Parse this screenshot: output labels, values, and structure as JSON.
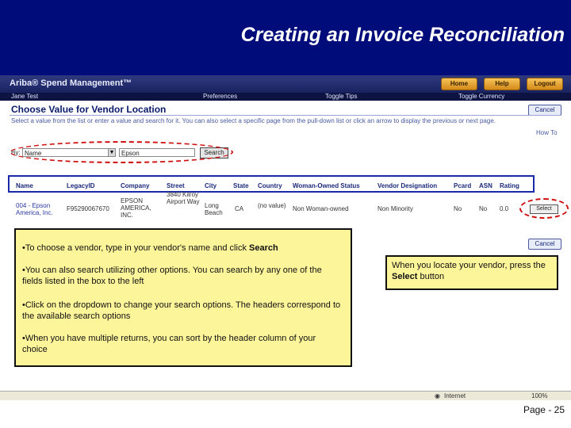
{
  "slide": {
    "title": "Creating an Invoice Reconciliation",
    "page_number": "Page - 25"
  },
  "app": {
    "logo": "Ariba® Spend Management™",
    "nav_buttons": [
      "Home",
      "Help",
      "Logout"
    ],
    "user": "Jane Test",
    "menu": [
      "Preferences",
      "Toggle Tips",
      "Toggle Currency"
    ],
    "panel_title": "Choose Value for Vendor Location",
    "cancel_label": "Cancel",
    "instructions": "Select a value from the list or enter a value and search for it. You can also select a specific page from the pull-down list or click an arrow to display the previous or next page.",
    "how_to": "How To",
    "search": {
      "label": "By:",
      "filter_value": "Name",
      "query_value": "Epson",
      "button": "Search"
    },
    "columns": [
      "Name",
      "LegacyID",
      "Company",
      "Street",
      "City",
      "State",
      "Country",
      "Woman-Owned Status",
      "Vendor Designation",
      "Pcard",
      "ASN",
      "Rating"
    ],
    "rows": [
      {
        "name": "004 - Epson America, Inc.",
        "legacy_id": "F95290067670",
        "company": "EPSON AMERICA, INC.",
        "street": "3840 Kilroy Airport Way",
        "city": "Long Beach",
        "state": "CA",
        "country": "(no value)",
        "woman_owned": "Non Woman-owned",
        "designation": "Non Minority",
        "pcard": "No",
        "asn": "No",
        "rating": "0.0",
        "select_label": "Select"
      }
    ],
    "status_zone": "Internet",
    "zoom": "100%"
  },
  "callouts": {
    "main": [
      "•To choose a vendor, type in your vendor's name and click ",
      "Search",
      "•You can also search utilizing other options.  You can search by any one of the fields listed in the box to the left",
      "•Click on the dropdown to change your search options. The headers correspond to the available search options",
      "•When you have multiple returns, you can sort by the header column of your choice"
    ],
    "right_prefix": "When you locate your vendor, press the ",
    "right_bold": "Select",
    "right_suffix": " button"
  },
  "colors": {
    "banner": "#000c7a",
    "callout_fill": "#fdf59a",
    "highlight_red": "#d01010",
    "highlight_blue": "#1a2aa8"
  }
}
